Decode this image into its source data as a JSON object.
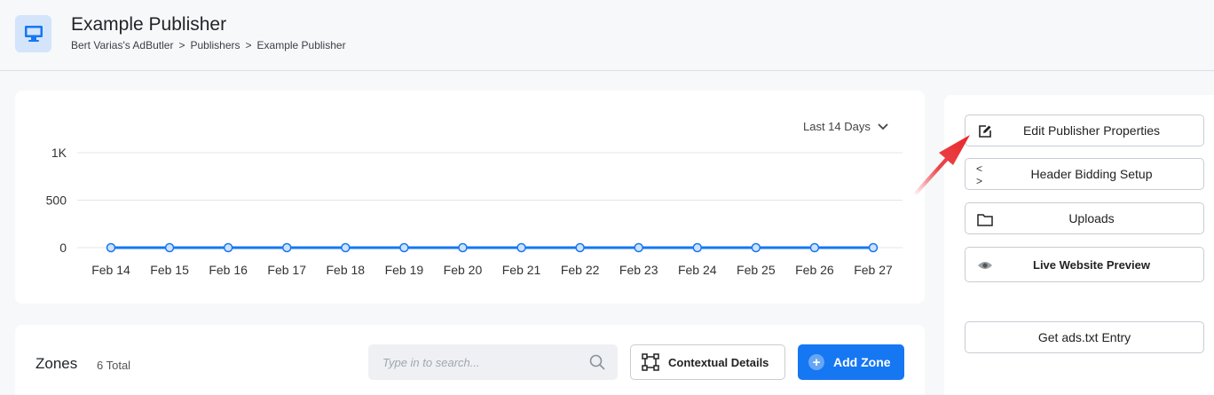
{
  "header": {
    "icon": "monitor-icon",
    "title": "Example Publisher",
    "breadcrumb": [
      "Bert Varias's AdButler",
      "Publishers",
      "Example Publisher"
    ],
    "separator": ">"
  },
  "chart": {
    "range_label": "Last 14 Days"
  },
  "chart_data": {
    "type": "line",
    "categories": [
      "Feb 14",
      "Feb 15",
      "Feb 16",
      "Feb 17",
      "Feb 18",
      "Feb 19",
      "Feb 20",
      "Feb 21",
      "Feb 22",
      "Feb 23",
      "Feb 24",
      "Feb 25",
      "Feb 26",
      "Feb 27"
    ],
    "series": [
      {
        "values": [
          0,
          0,
          0,
          0,
          0,
          0,
          0,
          0,
          0,
          0,
          0,
          0,
          0,
          0
        ],
        "color": "#1677f2"
      }
    ],
    "y_ticks": [
      {
        "value": 0,
        "label": "0"
      },
      {
        "value": 500,
        "label": "500"
      },
      {
        "value": 1000,
        "label": "1K"
      }
    ],
    "ylim": [
      0,
      1000
    ],
    "grid": true,
    "legend": "none"
  },
  "zones": {
    "title": "Zones",
    "count": "6 Total",
    "search_placeholder": "Type in to search...",
    "contextual_label": "Contextual Details",
    "add_label": "Add Zone"
  },
  "sidebar": {
    "edit_label": "Edit Publisher Properties",
    "header_bidding_label": "Header Bidding Setup",
    "uploads_label": "Uploads",
    "preview_label": "Live Website Preview",
    "ads_txt_label": "Get ads.txt Entry",
    "header_bidding_glyph": "< >"
  },
  "colors": {
    "accent": "#1677f2",
    "annotation_arrow": "#e8262b"
  }
}
